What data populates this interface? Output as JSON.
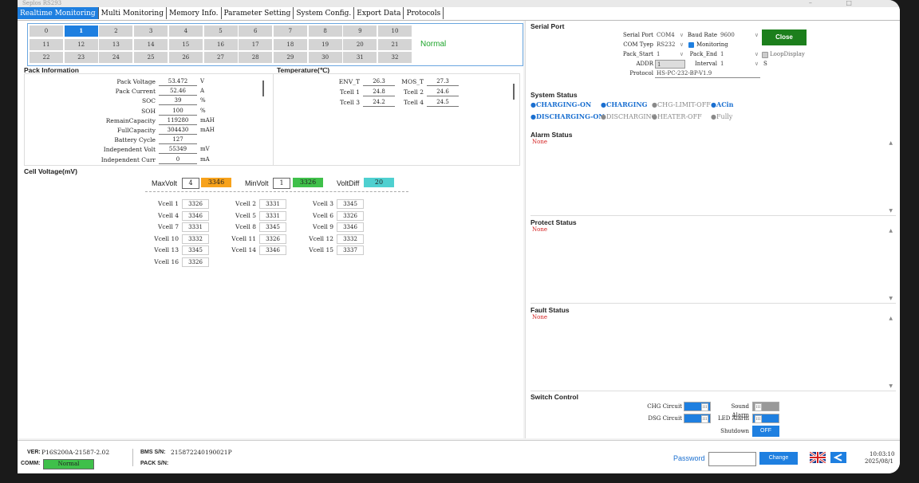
{
  "app_title": "Seplos RS293",
  "tabs": [
    "Realtime Monitoring",
    "Multi Monitoring",
    "Memory Info.",
    "Parameter Setting",
    "System Config.",
    "Export Data",
    "Protocols"
  ],
  "pack_grid": {
    "cells": [
      "0",
      "1",
      "2",
      "3",
      "4",
      "5",
      "6",
      "7",
      "8",
      "9",
      "10",
      "11",
      "12",
      "13",
      "14",
      "15",
      "16",
      "17",
      "18",
      "19",
      "20",
      "21",
      "22",
      "23",
      "24",
      "25",
      "26",
      "27",
      "28",
      "29",
      "30",
      "31",
      "32"
    ],
    "selected": "1",
    "status": "Normal"
  },
  "pack_info": {
    "title": "Pack Information",
    "rows": [
      {
        "label": "Pack Voltage",
        "value": "53.472",
        "unit": "V"
      },
      {
        "label": "Pack Current",
        "value": "52.46",
        "unit": "A"
      },
      {
        "label": "SOC",
        "value": "39",
        "unit": "%"
      },
      {
        "label": "SOH",
        "value": "100",
        "unit": "%"
      },
      {
        "label": "RemainCapacity",
        "value": "119280",
        "unit": "mAH"
      },
      {
        "label": "FullCapacity",
        "value": "304430",
        "unit": "mAH"
      },
      {
        "label": "Battery Cycle",
        "value": "127",
        "unit": ""
      },
      {
        "label": "Independent Volt",
        "value": "55349",
        "unit": "mV"
      },
      {
        "label": "Independent Curr",
        "value": "0",
        "unit": "mA"
      }
    ]
  },
  "temperature": {
    "title": "Temperature(℃)",
    "rows": [
      [
        {
          "label": "ENV_T",
          "value": "26.3"
        },
        {
          "label": "MOS_T",
          "value": "27.3"
        }
      ],
      [
        {
          "label": "Tcell 1",
          "value": "24.8"
        },
        {
          "label": "Tcell 2",
          "value": "24.6"
        }
      ],
      [
        {
          "label": "Tcell 3",
          "value": "24.2"
        },
        {
          "label": "Tcell 4",
          "value": "24.5"
        }
      ]
    ]
  },
  "cell_voltage": {
    "title": "Cell Voltage(mV)",
    "max_label": "MaxVolt",
    "max_index": "4",
    "max_value": "3346",
    "min_label": "MinVolt",
    "min_index": "1",
    "min_value": "3326",
    "diff_label": "VoltDiff",
    "diff_value": "20",
    "cells": [
      {
        "label": "Vcell 1",
        "value": "3326"
      },
      {
        "label": "Vcell 2",
        "value": "3331"
      },
      {
        "label": "Vcell 3",
        "value": "3345"
      },
      {
        "label": "Vcell 4",
        "value": "3346"
      },
      {
        "label": "Vcell 5",
        "value": "3331"
      },
      {
        "label": "Vcell 6",
        "value": "3326"
      },
      {
        "label": "Vcell 7",
        "value": "3331"
      },
      {
        "label": "Vcell 8",
        "value": "3345"
      },
      {
        "label": "Vcell 9",
        "value": "3346"
      },
      {
        "label": "Vcell 10",
        "value": "3332"
      },
      {
        "label": "Vcell 11",
        "value": "3326"
      },
      {
        "label": "Vcell 12",
        "value": "3332"
      },
      {
        "label": "Vcell 13",
        "value": "3345"
      },
      {
        "label": "Vcell 14",
        "value": "3346"
      },
      {
        "label": "Vcell 15",
        "value": "3337"
      },
      {
        "label": "Vcell 16",
        "value": "3326"
      }
    ]
  },
  "serial_port": {
    "title": "Serial Port",
    "serial_port_label": "Serial Port",
    "serial_port_value": "COM4",
    "baud_rate_label": "Baud Rate",
    "baud_rate_value": "9600",
    "close_button": "Close",
    "com_type_label": "COM Tyep",
    "com_type_value": "RS232",
    "monitoring_label": "Monitoring",
    "pack_start_label": "Pack_Start",
    "pack_start_value": "1",
    "pack_end_label": "Pack_End",
    "pack_end_value": "1",
    "loop_display_label": "LoopDisplay",
    "adds_label": "ADDR",
    "adds_value": "1",
    "interval_label": "Interval",
    "interval_value": "1",
    "interval_unit": "S",
    "protocol_label": "Protocol",
    "protocol_value": "HS-PC-232-BP-V1.9"
  },
  "system_status": {
    "title": "System Status",
    "items": [
      {
        "text": "CHARGING-ON",
        "active": true
      },
      {
        "text": "CHARGING",
        "active": true
      },
      {
        "text": "CHG-LIMIT-OFF",
        "active": false
      },
      {
        "text": "ACin",
        "active": true
      },
      {
        "text": "DISCHARGING-ON",
        "active": true
      },
      {
        "text": "DISCHARGING",
        "active": false
      },
      {
        "text": "HEATER-OFF",
        "active": false
      },
      {
        "text": "Fully",
        "active": false
      }
    ]
  },
  "alarm_status": {
    "title": "Alarm Status",
    "value": "None"
  },
  "protect_status": {
    "title": "Protect Status",
    "value": "None"
  },
  "fault_status": {
    "title": "Fault Status",
    "value": "None"
  },
  "switch_control": {
    "title": "Switch Control",
    "chg_circuit": "CHG Circuit",
    "dsg_circuit": "DSG Circuit",
    "sound_alarm": "Sound Alarm",
    "led_alarm": "LED Alarm",
    "shutdown": "Shutdown",
    "shutdown_button": "OFF",
    "knob": "III"
  },
  "footer": {
    "ver_label": "VER:",
    "ver_value": "P16S200A-21587-2.02",
    "comm_label": "COMM:",
    "comm_value": "Normal",
    "bms_sn_label": "BMS S/N:",
    "bms_sn_value": "215872240190021P",
    "pack_sn_label": "PACK S/N:",
    "password_label": "Password",
    "change_button": "Change",
    "time": "10:03:10",
    "date": "2025/08/1"
  },
  "colors": {
    "accent": "#1e7fe0",
    "orange": "#f7a21b",
    "green": "#3fc04a",
    "teal": "#4fd0d0",
    "close_green": "#1c7f1c",
    "status_blue": "#1a6fd0",
    "alarm_red": "#d42020"
  }
}
